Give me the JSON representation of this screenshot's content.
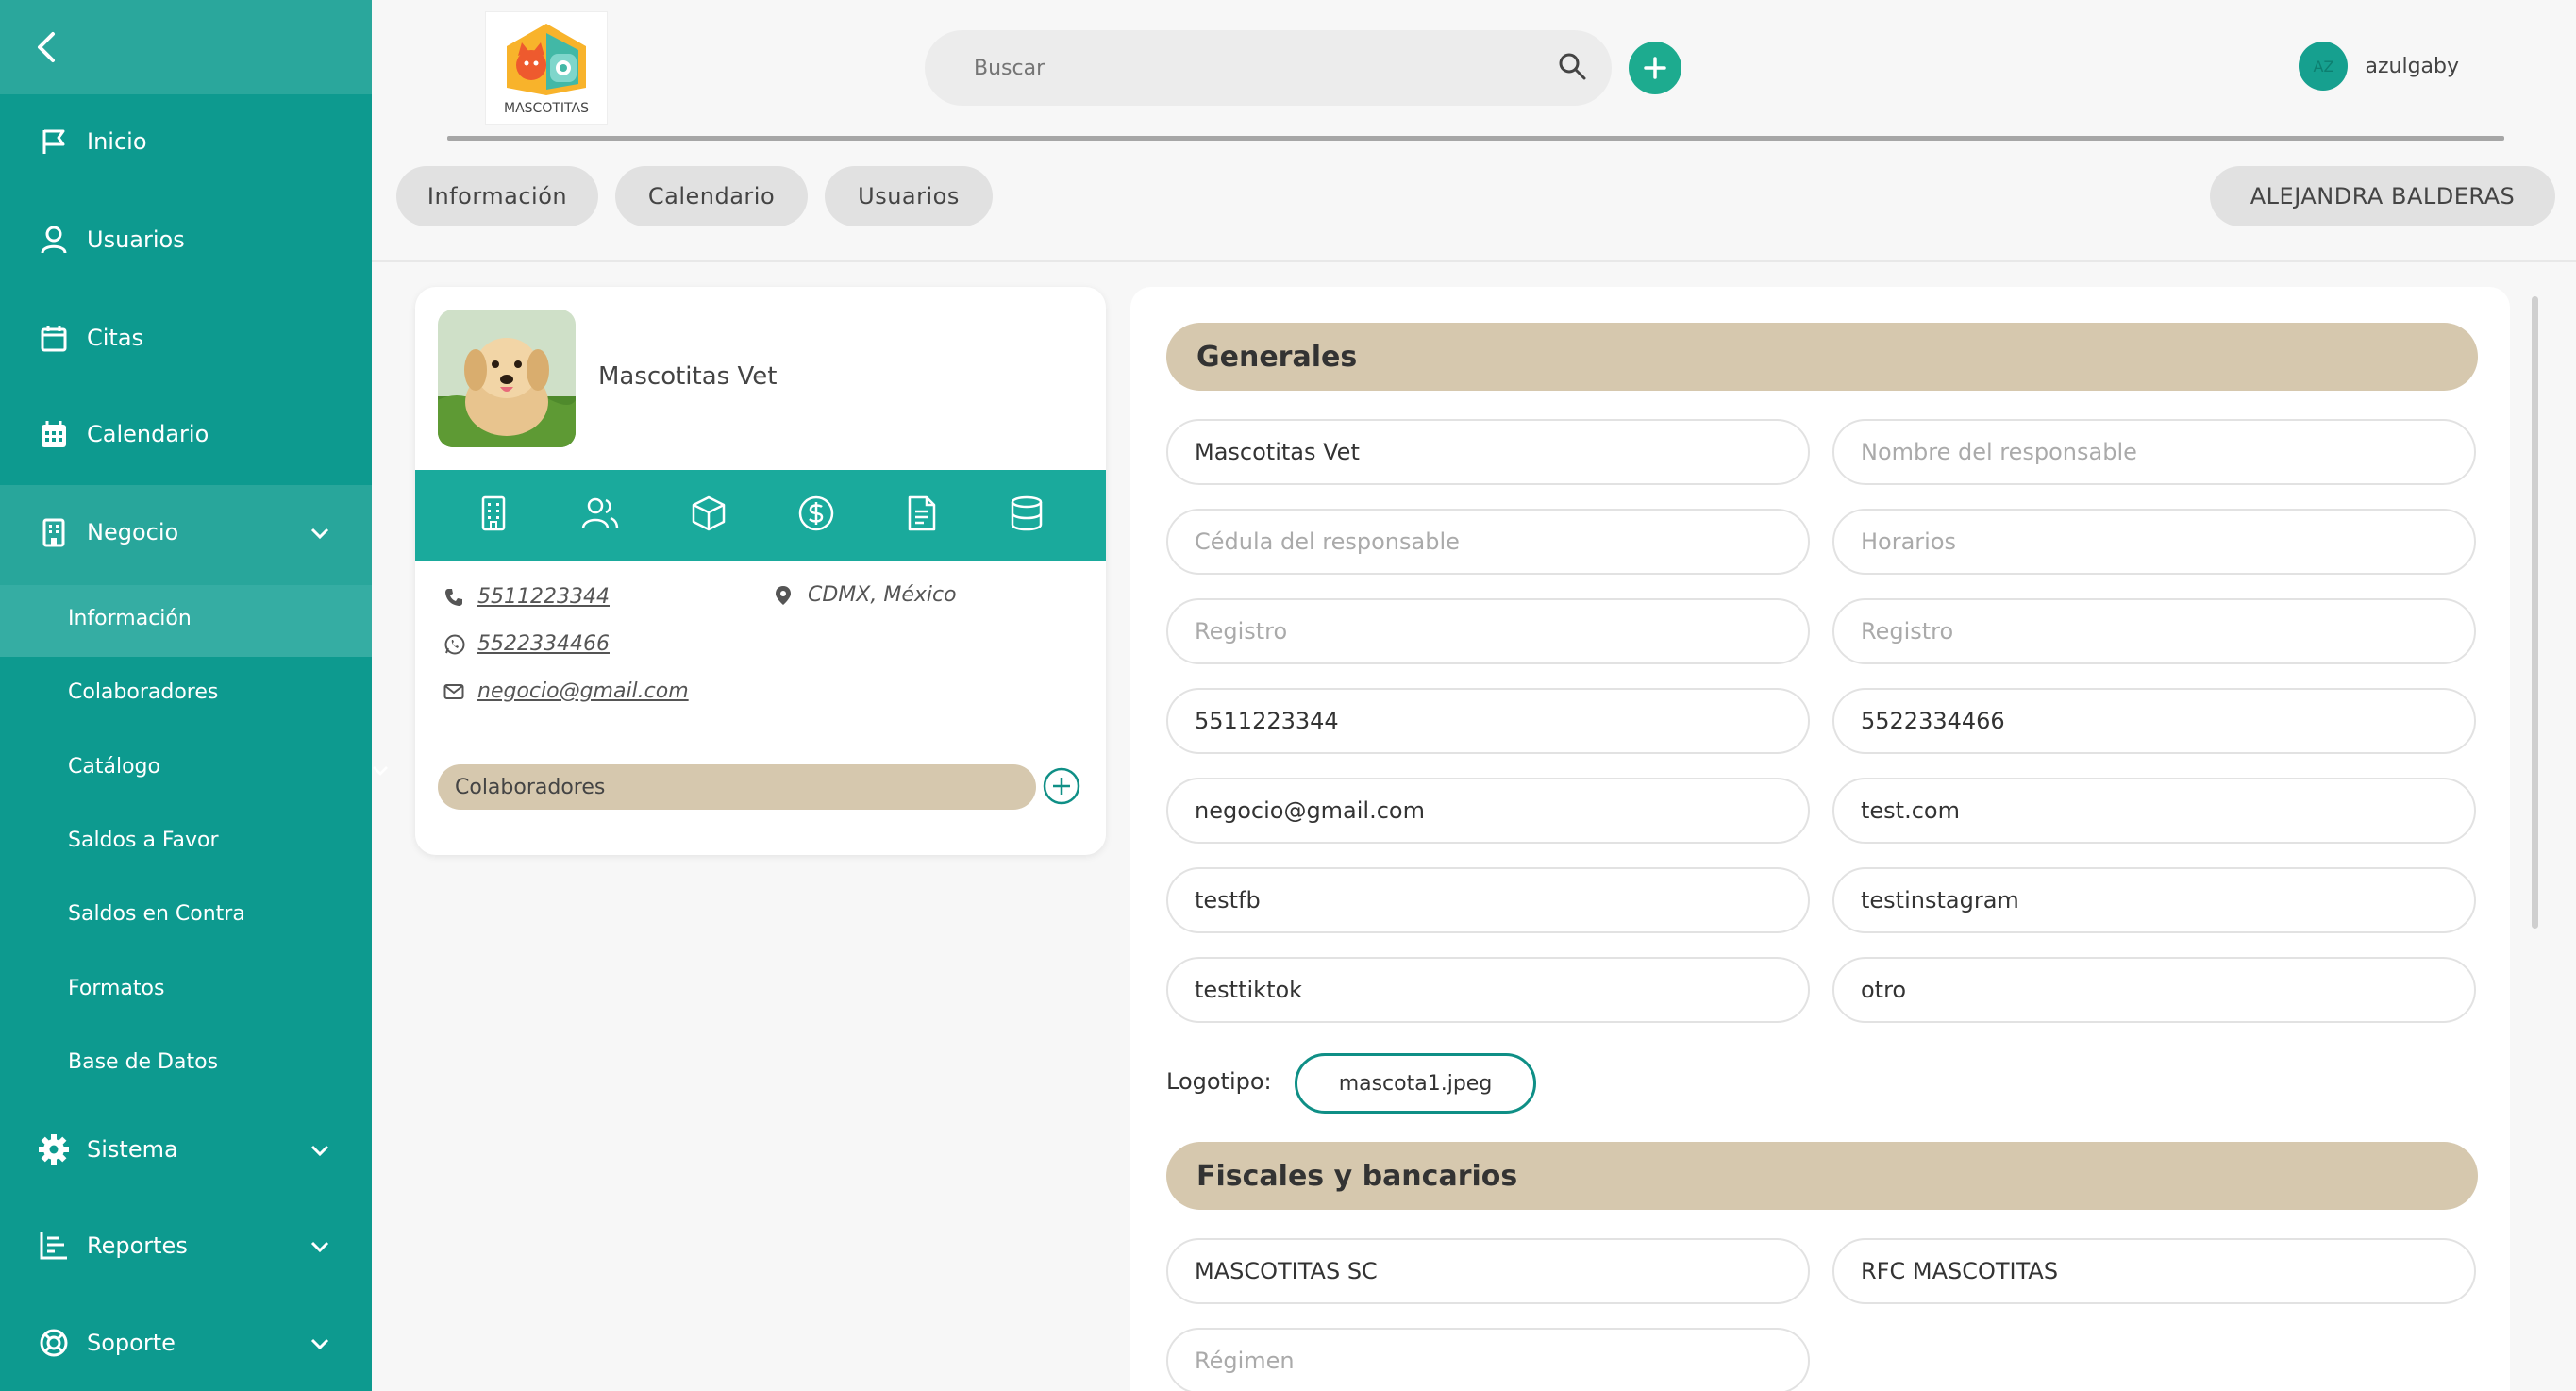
{
  "sidebar": {
    "items": [
      {
        "label": "Inicio",
        "icon": "flag-icon"
      },
      {
        "label": "Usuarios",
        "icon": "user-icon"
      },
      {
        "label": "Citas",
        "icon": "calendar-icon"
      },
      {
        "label": "Calendario",
        "icon": "calendar-grid-icon"
      },
      {
        "label": "Negocio",
        "icon": "building-icon"
      },
      {
        "label": "Sistema",
        "icon": "gear-icon"
      },
      {
        "label": "Reportes",
        "icon": "chart-icon"
      },
      {
        "label": "Soporte",
        "icon": "lifebuoy-icon"
      }
    ],
    "sub_items": [
      {
        "label": "Información"
      },
      {
        "label": "Colaboradores"
      },
      {
        "label": "Catálogo"
      },
      {
        "label": "Saldos a Favor"
      },
      {
        "label": "Saldos en Contra"
      },
      {
        "label": "Formatos"
      },
      {
        "label": "Base de Datos"
      }
    ]
  },
  "header": {
    "logo_text": "MASCOTITAS",
    "search_placeholder": "Buscar",
    "avatar_initials": "AZ",
    "username": "azulgaby"
  },
  "tabs": [
    {
      "label": "Información"
    },
    {
      "label": "Calendario"
    },
    {
      "label": "Usuarios"
    }
  ],
  "current_user_badge": "ALEJANDRA BALDERAS",
  "business_card": {
    "name": "Mascotitas Vet",
    "phone": "5511223344",
    "whatsapp": "5522334466",
    "email": "negocio@gmail.com",
    "location": "CDMX, México",
    "collaborators_label": "Colaboradores",
    "toolbar_icons": [
      "building-icon",
      "users-icon",
      "box-icon",
      "dollar-icon",
      "document-icon",
      "database-icon"
    ]
  },
  "form": {
    "generales_title": "Generales",
    "fiscales_title": "Fiscales y bancarios",
    "fields": {
      "nombre": {
        "value": "Mascotitas Vet",
        "placeholder": ""
      },
      "responsable": {
        "value": "",
        "placeholder": "Nombre del responsable"
      },
      "cedula": {
        "value": "",
        "placeholder": "Cédula del responsable"
      },
      "horarios": {
        "value": "",
        "placeholder": "Horarios"
      },
      "registro1": {
        "value": "",
        "placeholder": "Registro"
      },
      "registro2": {
        "value": "",
        "placeholder": "Registro"
      },
      "telefono": {
        "value": "5511223344",
        "placeholder": ""
      },
      "whatsapp": {
        "value": "5522334466",
        "placeholder": ""
      },
      "email": {
        "value": "negocio@gmail.com",
        "placeholder": ""
      },
      "web": {
        "value": "test.com",
        "placeholder": ""
      },
      "facebook": {
        "value": "testfb",
        "placeholder": ""
      },
      "instagram": {
        "value": "testinstagram",
        "placeholder": ""
      },
      "tiktok": {
        "value": "testtiktok",
        "placeholder": ""
      },
      "otro": {
        "value": "otro",
        "placeholder": ""
      },
      "razon_social": {
        "value": "MASCOTITAS SC",
        "placeholder": ""
      },
      "rfc": {
        "value": "RFC MASCOTITAS",
        "placeholder": ""
      },
      "regimen": {
        "value": "",
        "placeholder": "Régimen"
      }
    },
    "logo_label": "Logotipo:",
    "logo_file": "mascota1.jpeg"
  },
  "colors": {
    "sidebar": "#0d9a8f",
    "accent": "#1aaa9c",
    "section": "#d6c8ae"
  }
}
